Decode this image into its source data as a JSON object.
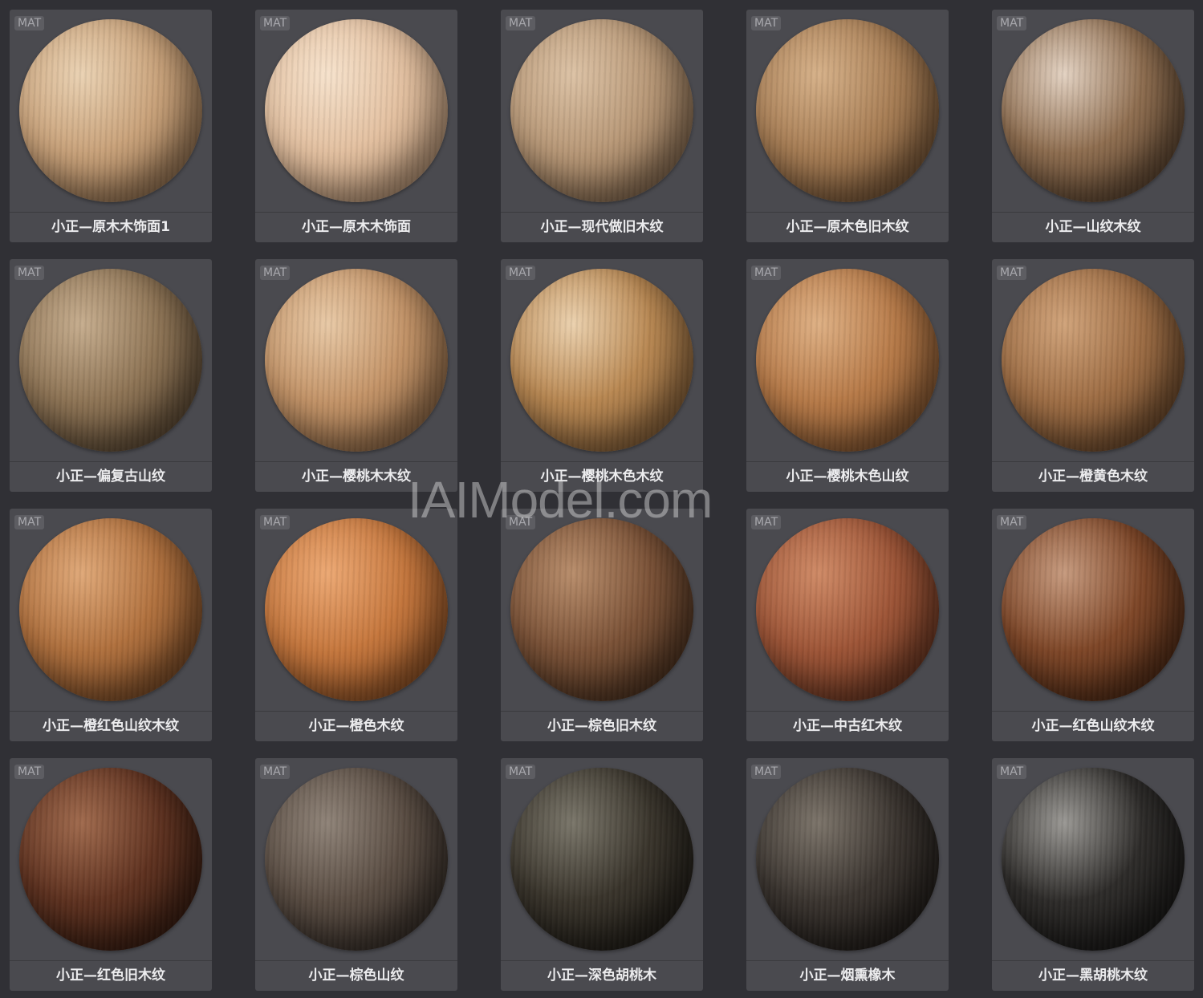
{
  "badge": "MAT",
  "watermark": "IAIModel.com",
  "materials": [
    {
      "label": "小正—原木木饰面1",
      "base": "#c9a27a",
      "light": "#ead2b3",
      "dark": "#8a6644"
    },
    {
      "label": "小正—原木木饰面",
      "base": "#e3c0a0",
      "light": "#f6e2cc",
      "dark": "#b08a68"
    },
    {
      "label": "小正—现代做旧木纹",
      "base": "#b89877",
      "light": "#dcc2a5",
      "dark": "#7a5d42"
    },
    {
      "label": "小正—原木色旧木纹",
      "base": "#a87e55",
      "light": "#d6b189",
      "dark": "#6b4a2c"
    },
    {
      "label": "小正—山纹木纹",
      "base": "#8f6e50",
      "light": "#e3d2c2",
      "dark": "#4e3825"
    },
    {
      "label": "小正—偏复古山纹",
      "base": "#8e7455",
      "light": "#c6ad8e",
      "dark": "#4f3d29"
    },
    {
      "label": "小正—樱桃木木纹",
      "base": "#c49468",
      "light": "#e8c9a6",
      "dark": "#87603d"
    },
    {
      "label": "小正—樱桃木色木纹",
      "base": "#b98852",
      "light": "#ebd1ae",
      "dark": "#7a5530"
    },
    {
      "label": "小正—樱桃木色山纹",
      "base": "#b77a48",
      "light": "#deb084",
      "dark": "#7a4d28"
    },
    {
      "label": "小正—橙黄色木纹",
      "base": "#9f6e45",
      "light": "#d0a37a",
      "dark": "#5e3e22"
    },
    {
      "label": "小正—橙红色山纹木纹",
      "base": "#b1713e",
      "light": "#dfa878",
      "dark": "#70421f"
    },
    {
      "label": "小正—橙色木纹",
      "base": "#c6773d",
      "light": "#eca873",
      "dark": "#84471c"
    },
    {
      "label": "小正—棕色旧木纹",
      "base": "#7b5237",
      "light": "#b88d6b",
      "dark": "#3f2817"
    },
    {
      "label": "小正—中古红木纹",
      "base": "#9e5537",
      "light": "#cf8a66",
      "dark": "#5f2e1a"
    },
    {
      "label": "小正—红色山纹木纹",
      "base": "#7f4728",
      "light": "#c69a7e",
      "dark": "#43220f"
    },
    {
      "label": "小正—红色旧木纹",
      "base": "#5f3220",
      "light": "#a06a4d",
      "dark": "#2c150b"
    },
    {
      "label": "小正—棕色山纹",
      "base": "#5a4d43",
      "light": "#8f8378",
      "dark": "#2a231e"
    },
    {
      "label": "小正—深色胡桃木",
      "base": "#3a352c",
      "light": "#7a766a",
      "dark": "#17140f"
    },
    {
      "label": "小正—烟熏橡木",
      "base": "#3b3530",
      "light": "#7c746a",
      "dark": "#171310"
    },
    {
      "label": "小正—黑胡桃木纹",
      "base": "#2e2c2a",
      "light": "#9a9894",
      "dark": "#121110"
    }
  ]
}
